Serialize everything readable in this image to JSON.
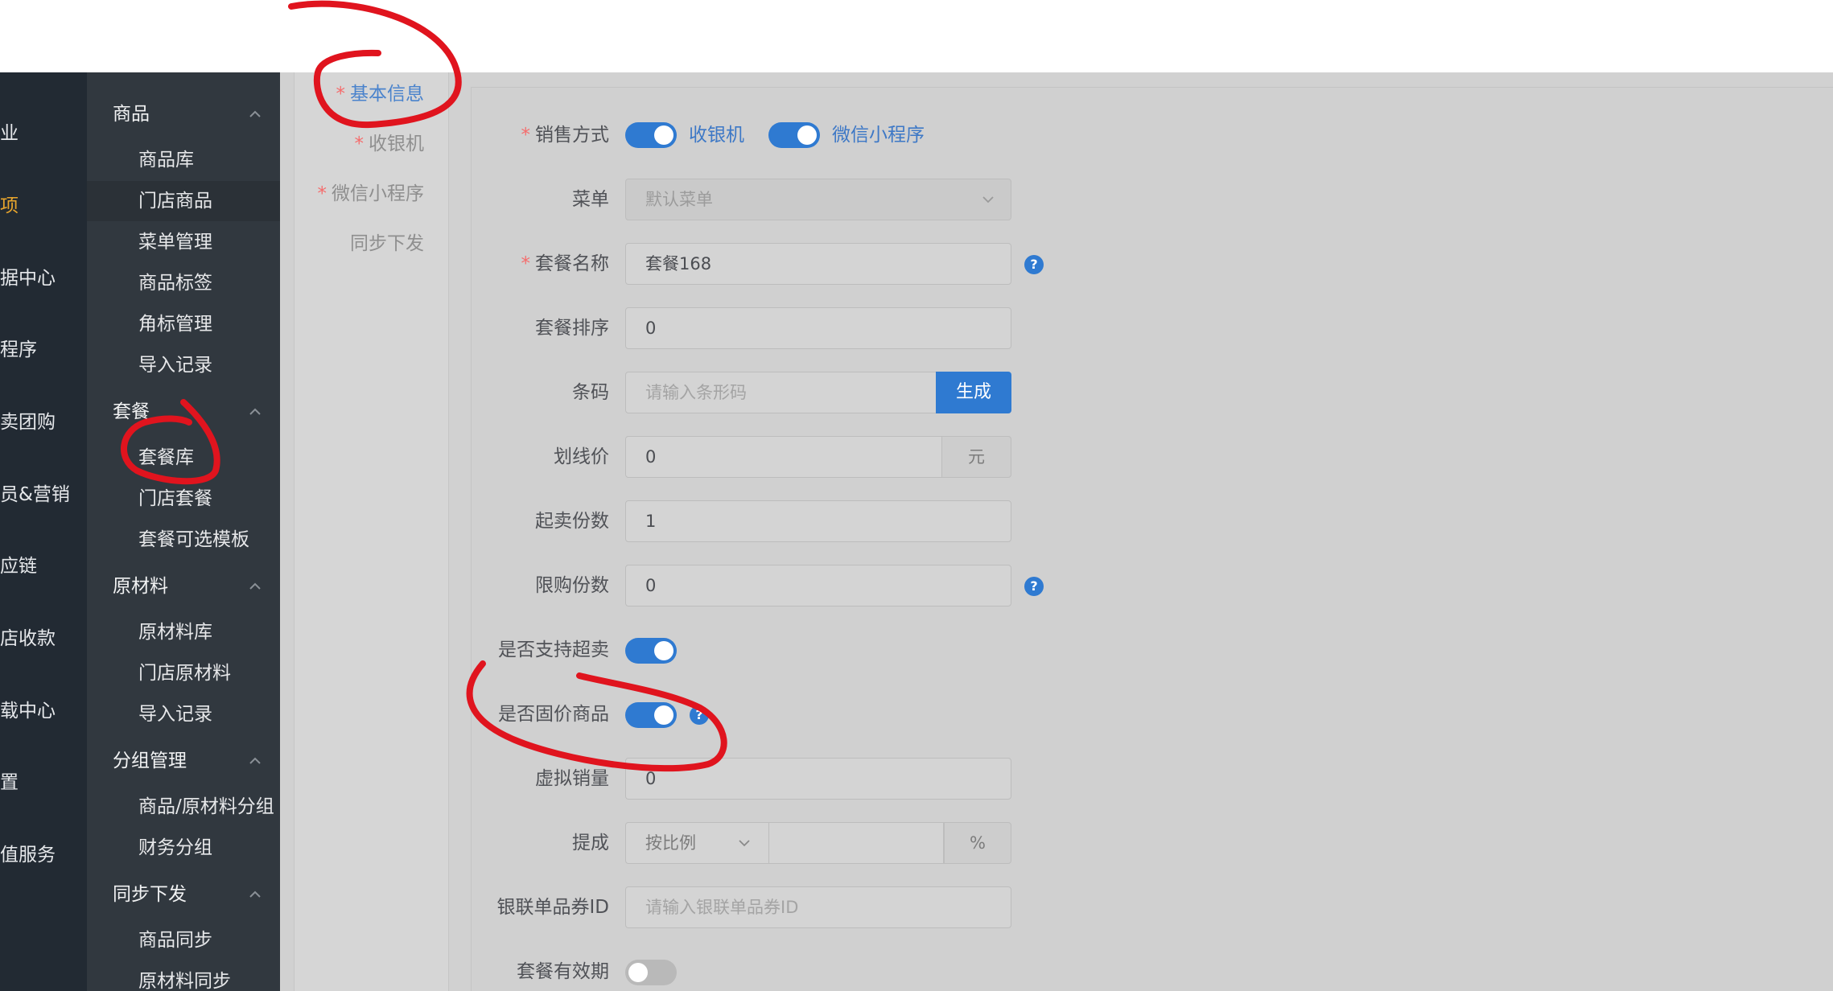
{
  "nav_primary": [
    {
      "label": "业",
      "active": false
    },
    {
      "label": "项",
      "active": true
    },
    {
      "label": "据中心",
      "active": false
    },
    {
      "label": "程序",
      "active": false
    },
    {
      "label": "卖团购",
      "active": false
    },
    {
      "label": "员&营销",
      "active": false
    },
    {
      "label": "应链",
      "active": false
    },
    {
      "label": "店收款",
      "active": false
    },
    {
      "label": "载中心",
      "active": false
    },
    {
      "label": "置",
      "active": false
    },
    {
      "label": "值服务",
      "active": false
    }
  ],
  "nav_secondary": {
    "goods": {
      "title": "商品",
      "items": [
        "商品库",
        "门店商品",
        "菜单管理",
        "商品标签",
        "角标管理",
        "导入记录"
      ]
    },
    "combo": {
      "title": "套餐",
      "items": [
        "套餐库",
        "门店套餐",
        "套餐可选模板"
      ]
    },
    "material": {
      "title": "原材料",
      "items": [
        "原材料库",
        "门店原材料",
        "导入记录"
      ]
    },
    "group": {
      "title": "分组管理",
      "items": [
        "商品/原材料分组",
        "财务分组"
      ]
    },
    "sync": {
      "title": "同步下发",
      "items": [
        "商品同步",
        "原材料同步"
      ]
    }
  },
  "steps": [
    {
      "label": "基本信息",
      "required": true,
      "active": true
    },
    {
      "label": "收银机",
      "required": true,
      "active": false
    },
    {
      "label": "微信小程序",
      "required": true,
      "active": false
    },
    {
      "label": "同步下发",
      "required": false,
      "active": false
    }
  ],
  "form": {
    "sale_mode": {
      "label": "销售方式",
      "required": true,
      "option1": "收银机",
      "option1_on": true,
      "option2": "微信小程序",
      "option2_on": true
    },
    "menu": {
      "label": "菜单",
      "value": "默认菜单"
    },
    "combo_name": {
      "label": "套餐名称",
      "required": true,
      "value": "套餐168"
    },
    "sort": {
      "label": "套餐排序",
      "value": "0"
    },
    "barcode": {
      "label": "条码",
      "placeholder": "请输入条形码",
      "button": "生成"
    },
    "list_price": {
      "label": "划线价",
      "value": "0",
      "unit": "元"
    },
    "min_qty": {
      "label": "起卖份数",
      "value": "1"
    },
    "limit_qty": {
      "label": "限购份数",
      "value": "0"
    },
    "oversell": {
      "label": "是否支持超卖",
      "on": true
    },
    "fixed_price": {
      "label": "是否固价商品",
      "on": true
    },
    "virtual_sales": {
      "label": "虚拟销量",
      "value": "0"
    },
    "commission": {
      "label": "提成",
      "mode": "按比例",
      "value": "",
      "unit": "%"
    },
    "unionpay_id": {
      "label": "银联单品券ID",
      "placeholder": "请输入银联单品券ID"
    },
    "validity": {
      "label": "套餐有效期",
      "on": false
    }
  },
  "colors": {
    "accent": "#2f7ad1",
    "nav_dark": "#222a33",
    "nav_sub": "#31383f",
    "active_nav": "#e8a52c",
    "annotation": "#e0141e"
  }
}
